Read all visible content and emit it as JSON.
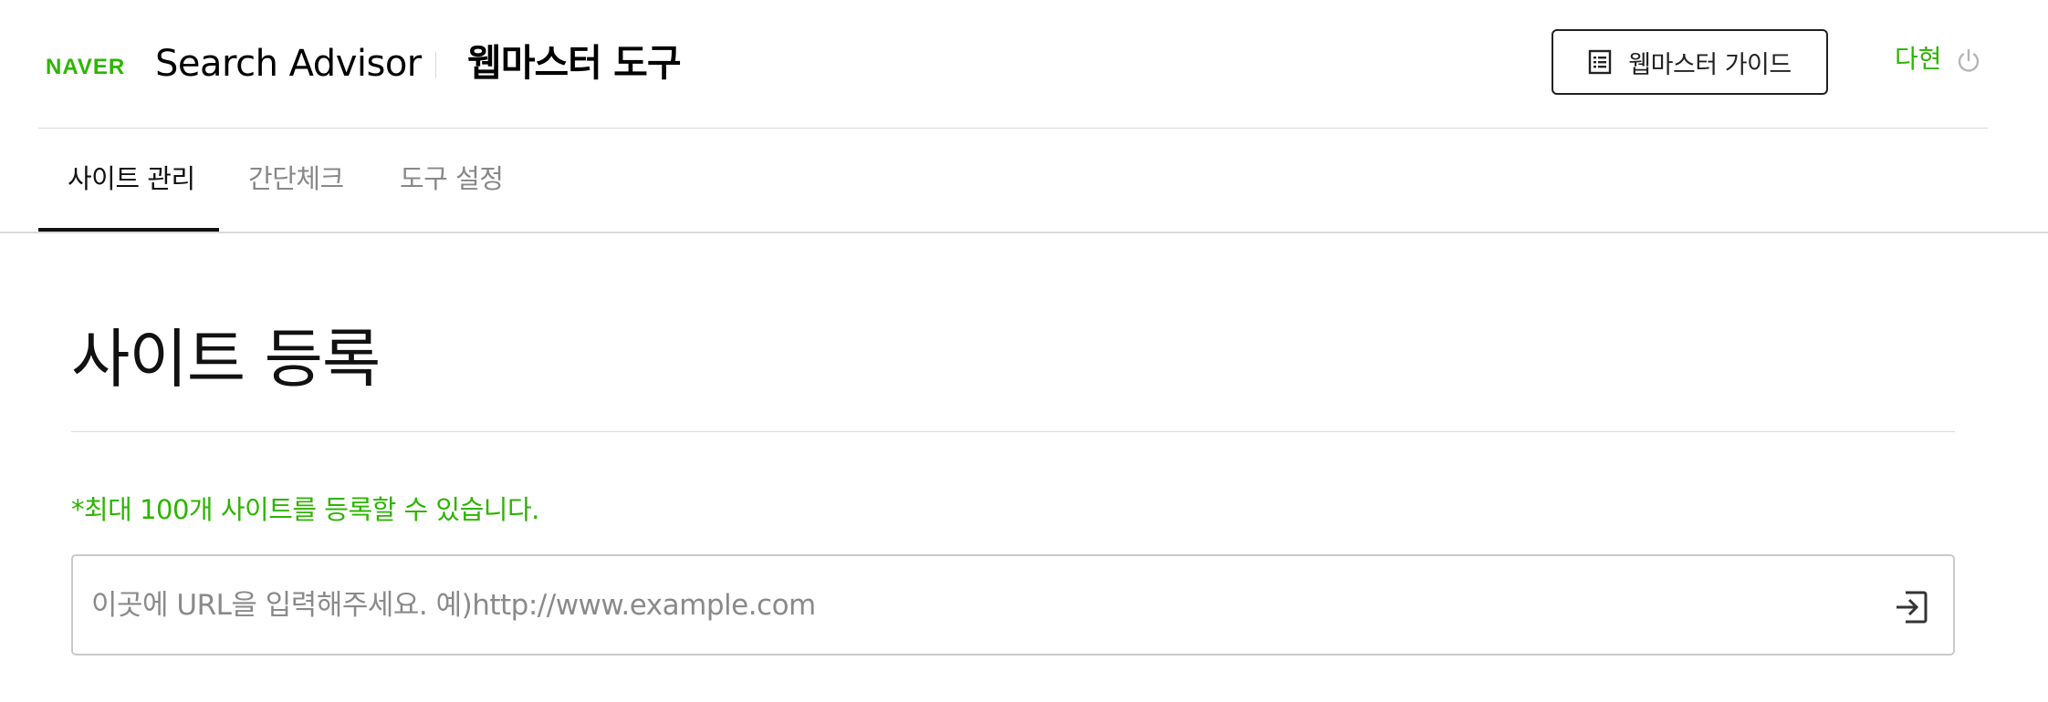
{
  "header": {
    "logo_text": "NAVER",
    "product_name": "Search Advisor",
    "service_name": "웹마스터 도구",
    "guide_button_label": "웹마스터 가이드",
    "user_name": "다현",
    "icons": {
      "guide": "list-document-icon",
      "logout": "power-icon"
    }
  },
  "tabs": [
    {
      "label": "사이트 관리",
      "active": true
    },
    {
      "label": "간단체크",
      "active": false
    },
    {
      "label": "도구 설정",
      "active": false
    }
  ],
  "main": {
    "page_title": "사이트 등록",
    "notice": "*최대 100개 사이트를 등록할 수 있습니다.",
    "url_input": {
      "value": "",
      "placeholder": "이곳에 URL을 입력해주세요. 예)http://www.example.com"
    },
    "submit_icon": "enter-arrow-icon"
  },
  "colors": {
    "brand_green": "#2db400",
    "text_primary": "#111111",
    "text_inactive": "#888888",
    "border": "#c9c9c9"
  }
}
